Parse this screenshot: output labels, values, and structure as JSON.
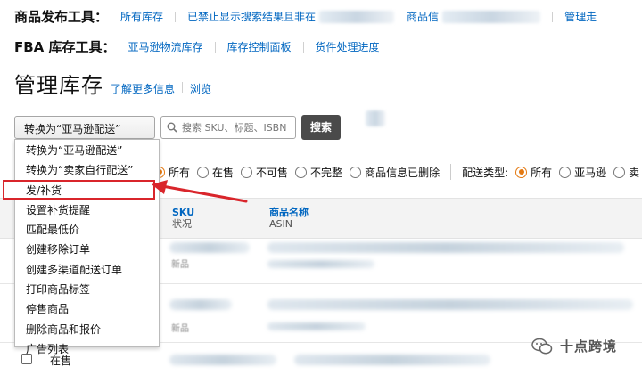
{
  "product_tools": {
    "title": "商品发布工具：",
    "links": [
      "所有库存",
      "已禁止显示搜索结果且非在",
      "商品信",
      "管理走"
    ]
  },
  "fba_tools": {
    "title": "FBA 库存工具：",
    "links": [
      "亚马逊物流库存",
      "库存控制面板",
      "货件处理进度"
    ]
  },
  "page": {
    "title": "管理库存",
    "learn_more": "了解更多信息",
    "browse": "浏览"
  },
  "action_menu": {
    "selected": "转换为“亚马逊配送”",
    "items": [
      "转换为“亚马逊配送”",
      "转换为“卖家自行配送”",
      "发/补货",
      "设置补货提醒",
      "匹配最低价",
      "创建移除订单",
      "创建多渠道配送订单",
      "打印商品标签",
      "停售商品",
      "删除商品和报价",
      "广告列表"
    ],
    "highlighted_index": 2,
    "highlight_color": "#d9252b"
  },
  "search": {
    "placeholder": "搜索 SKU、标题、ISBN",
    "button_label": "搜索"
  },
  "filters": {
    "status_options": [
      "所有",
      "在售",
      "不可售",
      "不完整",
      "商品信息已删除"
    ],
    "status_selected": "所有",
    "fulfillment_label": "配送类型:",
    "fulfillment_options": [
      "所有",
      "亚马逊",
      "卖"
    ],
    "fulfillment_selected": "所有"
  },
  "table": {
    "columns": [
      {
        "title": "SKU",
        "subtitle": "状况"
      },
      {
        "title": "商品名称",
        "subtitle": "ASIN"
      }
    ],
    "rows": [
      {
        "condition": "新品"
      },
      {
        "condition": "新品"
      },
      {
        "status": "在售"
      }
    ]
  },
  "watermark": {
    "text": "十点跨境"
  },
  "colors": {
    "link": "#0066c0",
    "accent": "#e47911",
    "annotation": "#d9252b",
    "search_button": "#4a4a4a"
  }
}
